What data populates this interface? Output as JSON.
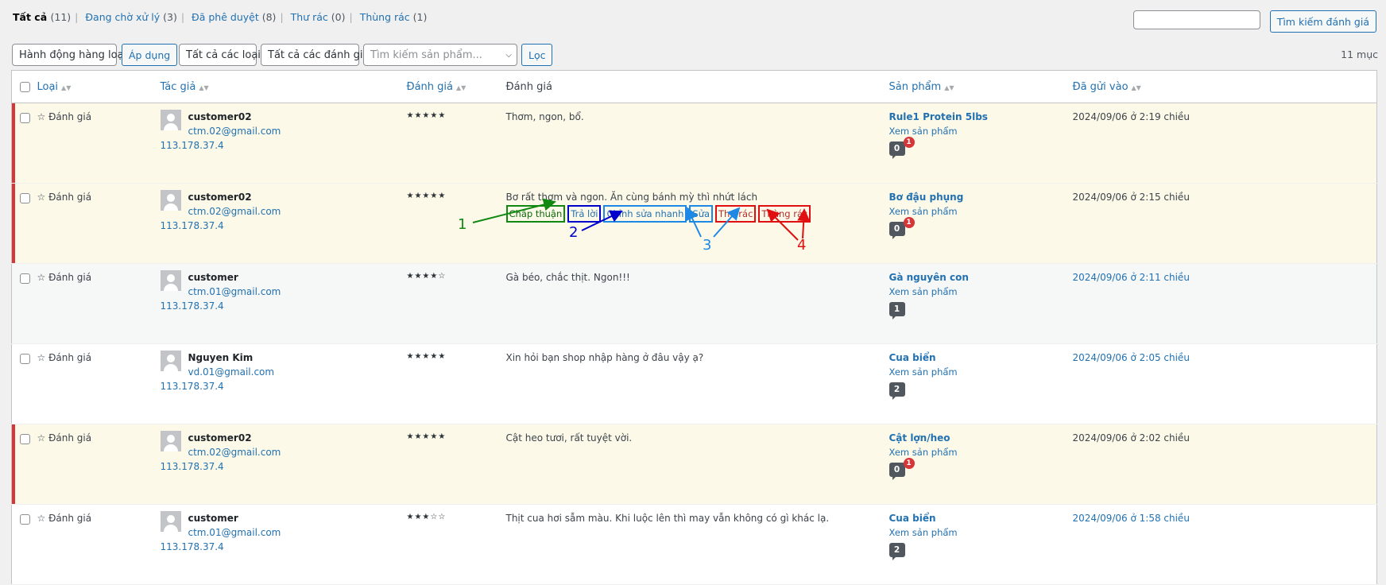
{
  "filters": {
    "all": {
      "label": "Tất cả",
      "count": "(11)"
    },
    "pending": {
      "label": "Đang chờ xử lý",
      "count": "(3)"
    },
    "approved": {
      "label": "Đã phê duyệt",
      "count": "(8)"
    },
    "spam": {
      "label": "Thư rác",
      "count": "(0)"
    },
    "trash": {
      "label": "Thùng rác",
      "count": "(1)"
    }
  },
  "search": {
    "button": "Tìm kiếm đánh giá"
  },
  "toolbar": {
    "bulk": "Hành động hàng loạt",
    "apply": "Áp dụng",
    "types": "Tất cả các loại",
    "ratings": "Tất cả các đánh giá",
    "product_placeholder": "Tìm kiếm sản phẩm...",
    "filter": "Lọc",
    "count": "11 mục"
  },
  "columns": {
    "type": "Loại",
    "author": "Tác giả",
    "rating": "Đánh giá",
    "review": "Đánh giá",
    "product": "Sản phẩm",
    "date": "Đã gửi vào"
  },
  "rows": [
    {
      "type": "☆ Đánh giá",
      "name": "customer02",
      "email": "ctm.02@gmail.com",
      "ip": "113.178.37.4",
      "stars": "★★★★★",
      "text": "Thơm, ngon, bổ.",
      "product": "Rule1 Protein 5lbs",
      "view": "Xem sản phẩm",
      "comments": "0",
      "pending": "1",
      "date": "2024/09/06 ở 2:19 chiều"
    },
    {
      "type": "☆ Đánh giá",
      "name": "customer02",
      "email": "ctm.02@gmail.com",
      "ip": "113.178.37.4",
      "stars": "★★★★★",
      "text": "Bơ rất thơm và ngon. Ăn cùng bánh mỳ thì nhứt lách",
      "product": "Bơ đậu phụng",
      "view": "Xem sản phẩm",
      "comments": "0",
      "pending": "1",
      "date": "2024/09/06 ở 2:15 chiều"
    },
    {
      "type": "☆ Đánh giá",
      "name": "customer",
      "email": "ctm.01@gmail.com",
      "ip": "113.178.37.4",
      "stars": "★★★★☆",
      "text": "Gà béo, chắc thịt. Ngon!!!",
      "product": "Gà nguyên con",
      "view": "Xem sản phẩm",
      "comments": "1",
      "pending": "",
      "date": "2024/09/06 ở 2:11 chiều"
    },
    {
      "type": "☆ Đánh giá",
      "name": "Nguyen Kim",
      "email": "vd.01@gmail.com",
      "ip": "113.178.37.4",
      "stars": "★★★★★",
      "text": "Xin hỏi bạn shop nhập hàng ở đâu vậy ạ?",
      "product": "Cua biển",
      "view": "Xem sản phẩm",
      "comments": "2",
      "pending": "",
      "date": "2024/09/06 ở 2:05 chiều"
    },
    {
      "type": "☆ Đánh giá",
      "name": "customer02",
      "email": "ctm.02@gmail.com",
      "ip": "113.178.37.4",
      "stars": "★★★★★",
      "text": "Cật heo tươi, rất tuyệt vời.",
      "product": "Cật lợn/heo",
      "view": "Xem sản phẩm",
      "comments": "0",
      "pending": "1",
      "date": "2024/09/06 ở 2:02 chiều"
    },
    {
      "type": "☆ Đánh giá",
      "name": "customer",
      "email": "ctm.01@gmail.com",
      "ip": "113.178.37.4",
      "stars": "★★★☆☆",
      "text": "Thịt cua hơi sẫm màu. Khi luộc lên thì may vẫn không có gì khác lạ.",
      "product": "Cua biển",
      "view": "Xem sản phẩm",
      "comments": "2",
      "pending": "",
      "date": "2024/09/06 ở 1:58 chiều"
    }
  ],
  "row_actions": {
    "approve": "Chấp thuận",
    "reply": "Trả lời",
    "quick_edit": "Chỉnh sửa nhanh",
    "edit": "Sửa",
    "spam": "Thư rác",
    "trash": "Thùng rác"
  },
  "annotations": {
    "n1": "1",
    "n2": "2",
    "n3": "3",
    "n4": "4"
  },
  "colors": {
    "green": "#118811",
    "blue": "#0000cc",
    "lightblue": "#1e88e5",
    "red": "#e01010"
  }
}
